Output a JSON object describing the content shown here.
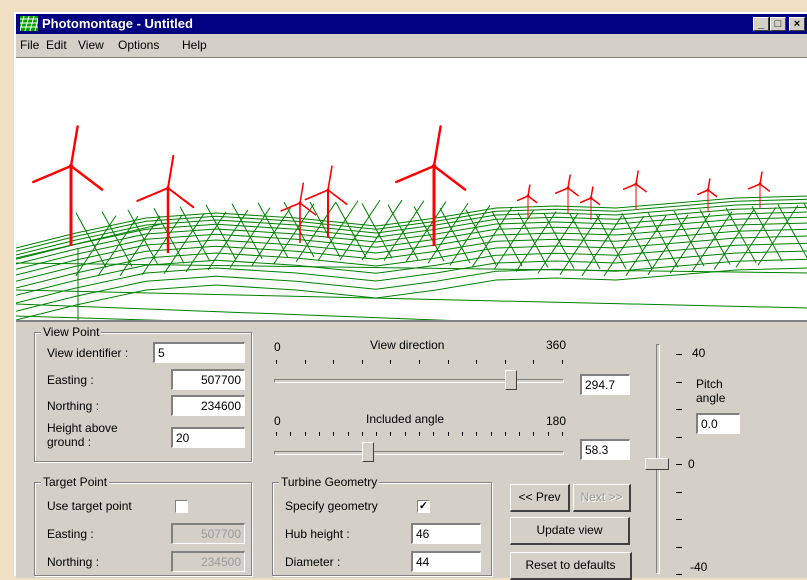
{
  "window": {
    "title": "Photomontage - Untitled",
    "controls": {
      "minimize": "_",
      "maximize": "□",
      "close": "×"
    }
  },
  "menu": [
    "File",
    "Edit",
    "View",
    "Options",
    "Help"
  ],
  "view_point": {
    "legend": "View Point",
    "view_identifier_label": "View identifier :",
    "view_identifier": "5",
    "easting_label": "Easting :",
    "easting": "507700",
    "northing_label": "Northing :",
    "northing": "234600",
    "height_label_1": "Height above",
    "height_label_2": "ground :",
    "height": "20"
  },
  "target_point": {
    "legend": "Target Point",
    "use_label": "Use target point",
    "use_checked": false,
    "easting_label": "Easting :",
    "easting": "507700",
    "northing_label": "Northing :",
    "northing": "234500"
  },
  "view_direction": {
    "title": "View direction",
    "min": "0",
    "max": "360",
    "value": "294.7",
    "position": 294.7,
    "range": 360
  },
  "included_angle": {
    "title": "Included angle",
    "min": "0",
    "max": "180",
    "value": "58.3",
    "position": 58.3,
    "range": 180
  },
  "turbine_geometry": {
    "legend": "Turbine Geometry",
    "specify_label": "Specify geometry",
    "specify_checked": true,
    "check_mark": "✓",
    "hub_height_label": "Hub height :",
    "hub_height": "46",
    "diameter_label": "Diameter :",
    "diameter": "44"
  },
  "buttons": {
    "prev": "<< Prev",
    "next": "Next >>",
    "update": "Update view",
    "reset": "Reset to defaults"
  },
  "pitch": {
    "label_1": "Pitch",
    "label_2": "angle",
    "value": "0.0",
    "max": "40",
    "zero": "0",
    "min": "-40"
  },
  "colors": {
    "title_bar": "#000080",
    "turbine": "#ff0000",
    "terrain": "#008000"
  },
  "icons": {
    "app": "wireframe-icon",
    "minimize": "minimize-icon",
    "maximize": "maximize-icon",
    "close": "close-icon"
  }
}
